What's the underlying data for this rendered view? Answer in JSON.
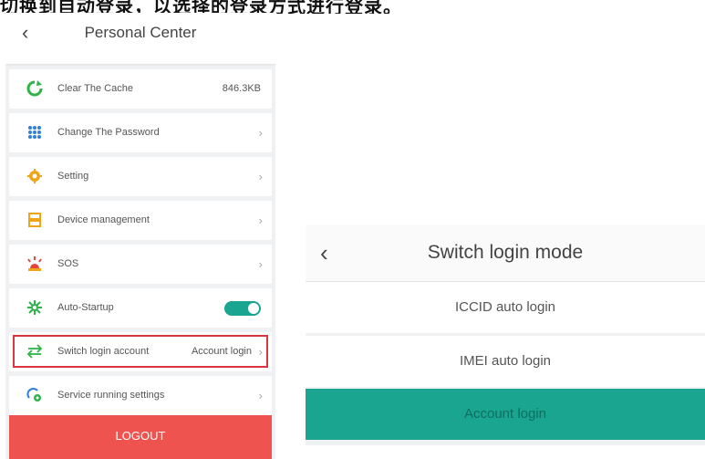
{
  "caption": "切换到自动登录，以选择的登录方式进行登录。",
  "personal_center": {
    "back_glyph": "‹",
    "title": "Personal Center",
    "items": [
      {
        "label": "Clear The Cache",
        "value": "846.3KB"
      },
      {
        "label": "Change The Password",
        "chevron": "›"
      },
      {
        "label": "Setting",
        "chevron": "›"
      },
      {
        "label": "Device management",
        "chevron": "›"
      },
      {
        "label": "SOS",
        "chevron": "›"
      },
      {
        "label": "Auto-Startup",
        "toggle_on": true
      },
      {
        "label": "Switch login account",
        "value": "Account login",
        "chevron": "›"
      },
      {
        "label": "Service running settings",
        "chevron": "›"
      }
    ],
    "logout_label": "LOGOUT"
  },
  "switch_login_mode": {
    "back_glyph": "‹",
    "title": "Switch login mode",
    "options": [
      {
        "label": "ICCID auto login",
        "selected": false
      },
      {
        "label": "IMEI auto login",
        "selected": false
      },
      {
        "label": "Account login",
        "selected": true
      }
    ]
  },
  "icons": {
    "clear_cache": "refresh-icon",
    "password": "keypad-icon",
    "setting": "gear-icon",
    "device": "device-icon",
    "sos": "alarm-icon",
    "autostart": "sparkle-icon",
    "switch": "swap-arrows-icon",
    "service": "cloud-gear-icon"
  },
  "colors": {
    "accent_teal": "#1aa591",
    "logout_red": "#ee5350",
    "highlight_red": "#d9363e",
    "icon_green": "#2fb44a",
    "icon_orange": "#f0a419",
    "icon_blue": "#2f7fd8"
  }
}
